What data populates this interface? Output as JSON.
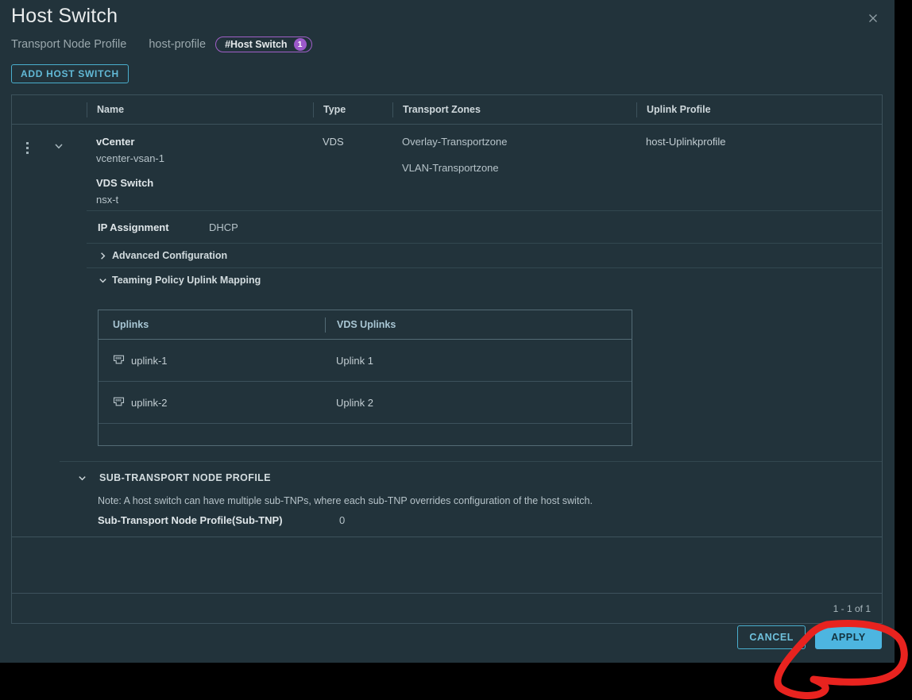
{
  "dialog": {
    "title": "Host Switch",
    "close_icon": "close-icon",
    "subhead": {
      "label": "Transport Node Profile",
      "value": "host-profile",
      "tag_label": "#Host Switch",
      "tag_count": "1"
    },
    "add_button": "ADD HOST SWITCH"
  },
  "table": {
    "columns": [
      "",
      "Name",
      "Type",
      "Transport Zones",
      "Uplink Profile"
    ],
    "row": {
      "kebab_icon": "kebab-menu-icon",
      "expand_icon": "chevron-down-icon",
      "name_label": "vCenter",
      "name_value": "vcenter-vsan-1",
      "switch_label": "VDS Switch",
      "switch_value": "nsx-t",
      "type": "VDS",
      "transport_zones": [
        "Overlay-Transportzone",
        "VLAN-Transportzone"
      ],
      "uplink_profile": "host-Uplinkprofile"
    },
    "ip_assignment": {
      "label": "IP Assignment",
      "value": "DHCP"
    },
    "advanced_config": {
      "label": "Advanced Configuration",
      "icon": "chevron-right-icon",
      "expanded": false
    },
    "teaming_policy": {
      "label": "Teaming Policy Uplink Mapping",
      "icon": "chevron-down-icon",
      "expanded": true
    },
    "uplink_mapping": {
      "columns": [
        "Uplinks",
        "VDS Uplinks"
      ],
      "rows": [
        {
          "icon": "ethernet-port-icon",
          "uplink": "uplink-1",
          "vds_uplink": "Uplink 1"
        },
        {
          "icon": "ethernet-port-icon",
          "uplink": "uplink-2",
          "vds_uplink": "Uplink 2"
        }
      ]
    },
    "sub_tnp": {
      "icon": "chevron-down-icon",
      "heading": "SUB-TRANSPORT NODE PROFILE",
      "note": "Note: A host switch can have multiple sub-TNPs, where each sub-TNP overrides configuration of the host switch.",
      "count_label": "Sub-Transport Node Profile(Sub-TNP)",
      "count_value": "0"
    },
    "pagination": "1 - 1 of 1"
  },
  "footer": {
    "cancel": "CANCEL",
    "apply": "APPLY"
  },
  "colors": {
    "dialog_bg": "#22333b",
    "page_bg": "#000000",
    "accent_blue": "#4db5e0",
    "link_blue": "#62b9d6",
    "tag_purple": "#9b59c9",
    "border": "#3d525c",
    "annotation_red": "#e8231f"
  }
}
